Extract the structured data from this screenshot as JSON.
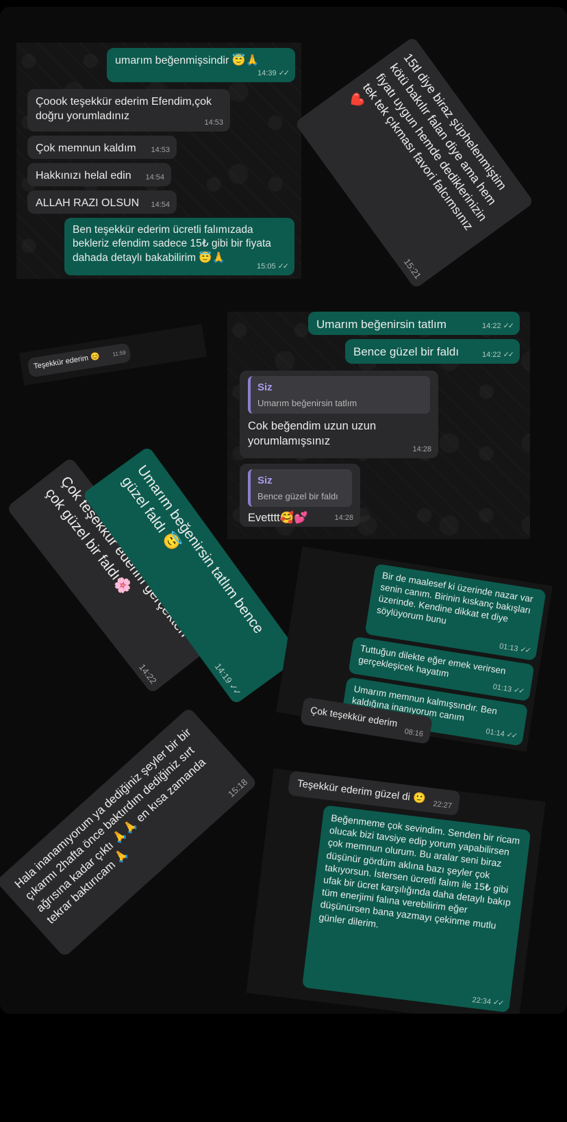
{
  "card1": {
    "m1": {
      "text": "umarım beğenmişsindir 😇🙏",
      "time": "14:39"
    },
    "m2": {
      "text": "Çoook teşekkür ederim Efendim,çok doğru yorumladınız",
      "time": "14:53"
    },
    "m3": {
      "text": "Çok memnun kaldım",
      "time": "14:53"
    },
    "m4": {
      "text": "Hakkınızı helal edin",
      "time": "14:54"
    },
    "m5": {
      "text": "ALLAH RAZI OLSUN",
      "time": "14:54"
    },
    "m6": {
      "text": "Ben teşekkür ederim ücretli falımızada bekleriz efendim sadece 15₺ gibi bir fiyata dahada detaylı bakabilirim 😇🙏",
      "time": "15:05"
    }
  },
  "card2": {
    "text": "15tl diye biraz şüphelenmiştim kötü bakılır falan diye ama hem fiyatı uygun hemde dediklerinizin tek tek çıkması favori falcımsınız ❤️",
    "time": "15:21"
  },
  "card3": {
    "text": "Teşekkür ederim 😊",
    "time": "11:59"
  },
  "card4": {
    "m1": {
      "text": "Umarım beğenirsin tatlım",
      "time": "14:22"
    },
    "m2": {
      "text": "Bence güzel bir faldı",
      "time": "14:22"
    },
    "r1": {
      "quote_name": "Siz",
      "quote_text": "Umarım beğenirsin tatlım",
      "text": "Cok beğendim uzun uzun yorumlamışsınız",
      "time": "14:28"
    },
    "r2": {
      "quote_name": "Siz",
      "quote_text": "Bence güzel bir faldı",
      "text": "Evetttt🥰💕",
      "time": "14:28"
    }
  },
  "card5": {
    "text": "Çok teşekkür ederim gerçekten çok güzel bir faldı🌸",
    "time": "14:22"
  },
  "card6": {
    "text": "Umarım beğenirsin tatlım bence güzel faldı 😇",
    "time": "14:19"
  },
  "card7": {
    "m1": {
      "text": "Bir de maalesef ki üzerinde nazar var senin canım. Birinin kıskanç bakışları üzerinde. Kendine dikkat et diye söylüyorum bunu",
      "time": "01:13"
    },
    "m2": {
      "text": "Tuttuğun dilekte eğer emek verirsen gerçekleşicek hayatım",
      "time": "01:13"
    },
    "m3": {
      "text": "Umarım memnun kalmışsındır. Ben kaldığına inanıyorum canım",
      "time": "01:14"
    },
    "m4": {
      "text": "Çok teşekkür ederim",
      "time": "08:16"
    }
  },
  "card8": {
    "text": "Hala inanamıyorum ya dediğiniz şeyler bir bir çıkarmı 2hafta önce baktırdım dediğiniz sırt ağrısına kadar çıktı 🙏🙏 en kısa zamanda tekrar baktırıcam 🙏",
    "time": "15:18"
  },
  "card9": {
    "m1": {
      "text": "Teşekkür ederim güzel di 🙂",
      "time": "22:27"
    },
    "m2": {
      "text": "Beğenmeme çok sevindim. Senden bir ricam olucak bizi tavsiye edip yorum yapabilirsen çok memnun olurum. Bu aralar seni biraz düşünür gördüm aklına bazı şeyler çok takıyorsun. İstersen ücretli falım ile 15₺ gibi ufak bir ücret karşılığında daha detaylı bakıp tüm enerjimi falına verebilirim eğer düşünürsen bana yazmayı çekinme mutlu günler dilerim.",
      "time": "22:34"
    }
  },
  "ticks": "✓✓",
  "colors": {
    "outgoing": "#0c5b4e",
    "incoming": "#2a2a2c",
    "quote_bar": "#8b7fd0"
  }
}
